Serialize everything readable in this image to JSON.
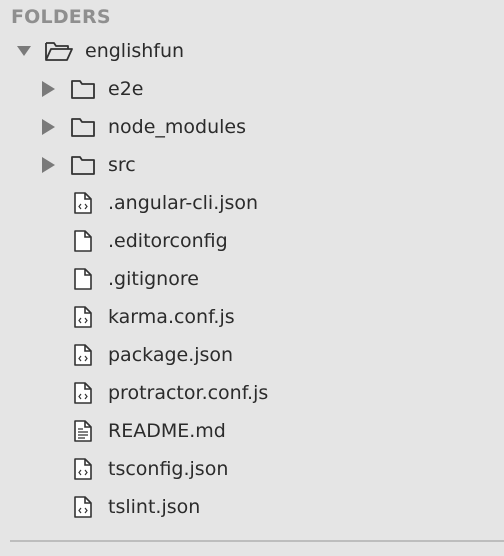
{
  "sidebar": {
    "header": "FOLDERS",
    "root": {
      "label": "englishfun",
      "expanded": true,
      "icon": "folder-open-icon"
    },
    "folders": [
      {
        "label": "e2e",
        "icon": "folder-icon",
        "expanded": false
      },
      {
        "label": "node_modules",
        "icon": "folder-icon",
        "expanded": false
      },
      {
        "label": "src",
        "icon": "folder-icon",
        "expanded": false
      }
    ],
    "files": [
      {
        "label": ".angular-cli.json",
        "icon": "code-file-icon"
      },
      {
        "label": ".editorconfig",
        "icon": "file-icon"
      },
      {
        "label": ".gitignore",
        "icon": "file-icon"
      },
      {
        "label": "karma.conf.js",
        "icon": "code-file-icon"
      },
      {
        "label": "package.json",
        "icon": "code-file-icon"
      },
      {
        "label": "protractor.conf.js",
        "icon": "code-file-icon"
      },
      {
        "label": "README.md",
        "icon": "text-file-icon"
      },
      {
        "label": "tsconfig.json",
        "icon": "code-file-icon"
      },
      {
        "label": "tslint.json",
        "icon": "code-file-icon"
      }
    ]
  }
}
